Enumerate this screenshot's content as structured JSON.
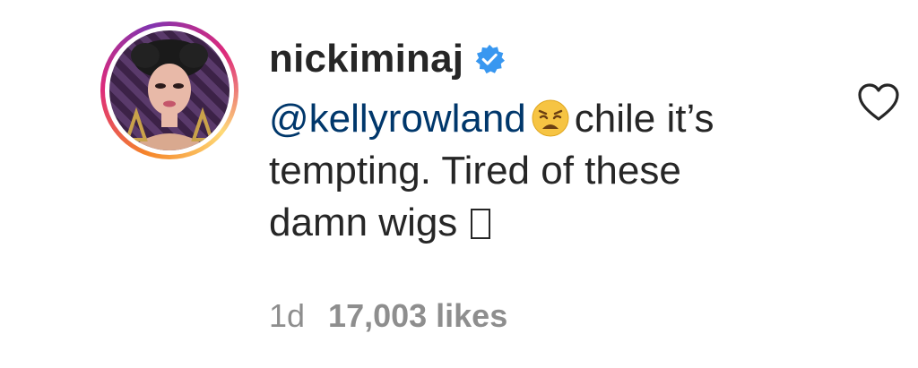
{
  "comment": {
    "username": "nickiminaj",
    "verified": true,
    "mention": "@kellyrowland",
    "emoji": "weary-face",
    "text_line1_after": "chile it’s",
    "text_line2": "tempting. Tired of these",
    "text_line3": "damn wigs",
    "trailing_glyph": "missing-glyph-box",
    "timestamp": "1d",
    "likes": "17,003 likes"
  },
  "colors": {
    "text": "#262626",
    "mention": "#00376b",
    "meta": "#8e8e8e",
    "verified": "#3897f0"
  },
  "icons": {
    "verified": "verified-badge-icon",
    "like": "heart-outline-icon"
  }
}
